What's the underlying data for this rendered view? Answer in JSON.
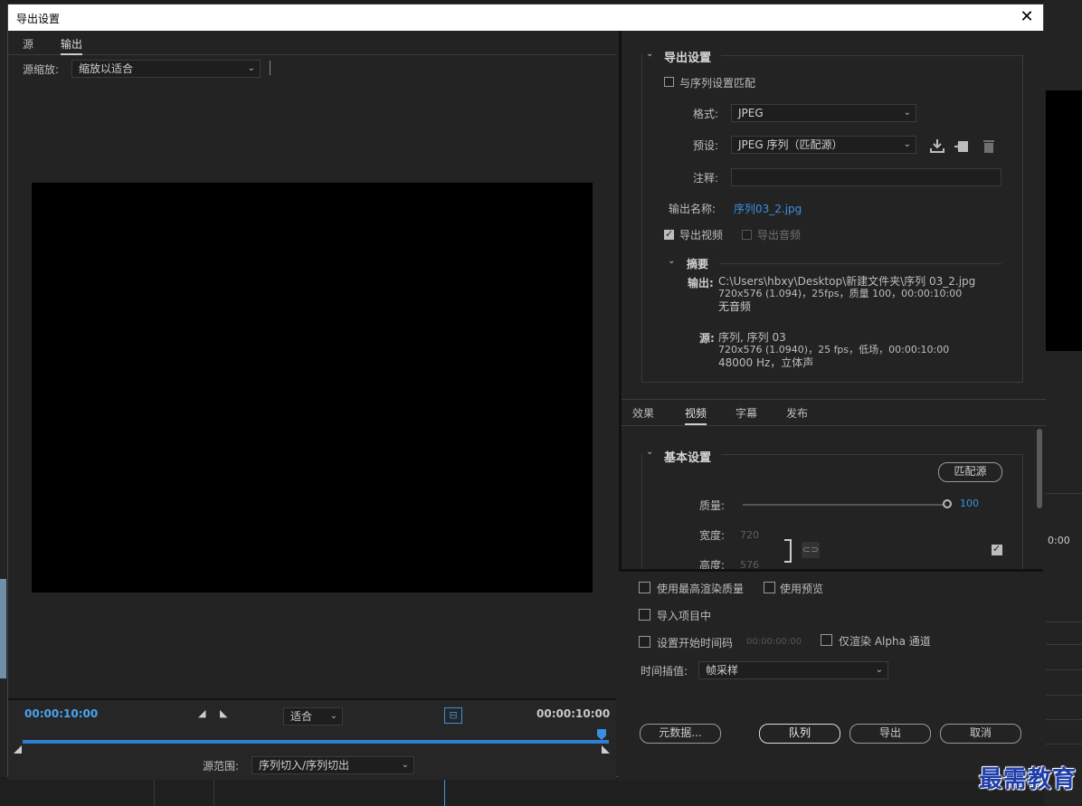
{
  "dialog": {
    "title": "导出设置",
    "close_glyph": "✕"
  },
  "left": {
    "tabs": [
      {
        "label": "源"
      },
      {
        "label": "输出"
      }
    ],
    "source_scale_label": "源缩放:",
    "source_scale_value": "缩放以适合",
    "timecode_in": "00:00:10:00",
    "timecode_out": "00:00:10:00",
    "fit_value": "适合",
    "source_range_label": "源范围:",
    "source_range_value": "序列切入/序列切出"
  },
  "export_settings": {
    "title": "导出设置",
    "match_sequence_label": "与序列设置匹配",
    "format_label": "格式:",
    "format_value": "JPEG",
    "preset_label": "预设:",
    "preset_value": "JPEG 序列（匹配源）",
    "comment_label": "注释:",
    "comment_value": "",
    "output_name_label": "输出名称:",
    "output_name_value": "序列03_2.jpg",
    "export_video_label": "导出视频",
    "export_audio_label": "导出音频",
    "summary_title": "摘要",
    "output_label": "输出:",
    "output_lines": [
      "C:\\Users\\hbxy\\Desktop\\新建文件夹\\序列 03_2.jpg",
      "720x576 (1.094)，25fps，质量 100，00:00:10:00",
      "无音频"
    ],
    "source_label": "源:",
    "source_lines": [
      "序列, 序列 03",
      "720x576 (1.0940)，25 fps，低场，00:00:10:00",
      "48000 Hz，立体声"
    ]
  },
  "subtabs": [
    {
      "label": "效果"
    },
    {
      "label": "视频"
    },
    {
      "label": "字幕"
    },
    {
      "label": "发布"
    }
  ],
  "basic_settings": {
    "title": "基本设置",
    "match_source_button": "匹配源",
    "quality_label": "质量:",
    "quality_value": "100",
    "quality_fraction": 1.0,
    "width_label": "宽度:",
    "width_value": "720",
    "height_label": "高度:",
    "height_value": "576"
  },
  "bottom": {
    "max_render_quality": "使用最高渲染质量",
    "use_previews": "使用预览",
    "import_into_project": "导入项目中",
    "set_start_timecode": "设置开始时间码",
    "start_timecode_value": "00:00:00:00",
    "render_alpha_only": "仅渲染 Alpha 通道",
    "time_interpolation_label": "时间插值:",
    "time_interpolation_value": "帧采样",
    "metadata_button": "元数据...",
    "queue_button": "队列",
    "export_button": "导出",
    "cancel_button": "取消"
  },
  "background": {
    "timecode_fragment": "0:00"
  },
  "watermark": "最需教育",
  "colors": {
    "accent": "#3b8fe0",
    "timeline_track": "#2f7fd1",
    "panel": "#232323"
  }
}
